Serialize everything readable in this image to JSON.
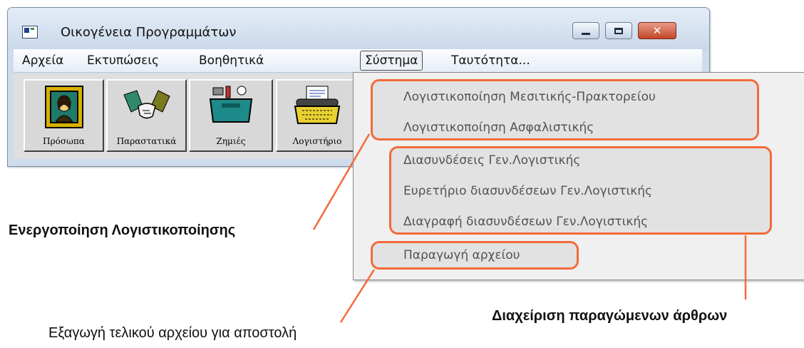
{
  "window": {
    "title": "Οικογένεια Προγραμμάτων"
  },
  "menubar": {
    "items": [
      {
        "label": "Αρχεία"
      },
      {
        "label": "Εκτυπώσεις"
      },
      {
        "label": "Βοηθητικά"
      },
      {
        "label": "Σύστημα"
      },
      {
        "label": "Ταυτότητα..."
      }
    ],
    "active_item": "Σύστημα"
  },
  "toolbar": {
    "buttons": [
      {
        "label": "Πρόσωπα",
        "icon": "portrait-frame-icon"
      },
      {
        "label": "Παραστατικά",
        "icon": "handshake-icon"
      },
      {
        "label": "Ζημιές",
        "icon": "toolbox-icon"
      },
      {
        "label": "Λογιστήριο",
        "icon": "typewriter-icon"
      }
    ]
  },
  "dropdown": {
    "items": [
      {
        "label": "Λογιστικοποίηση  Μεσιτικής-Πρακτορείου"
      },
      {
        "label": "Λογιστικοποίηση  Ασφαλιστικής"
      },
      {
        "label": "Διασυνδέσεις Γεν.Λογιστικής"
      },
      {
        "label": "Ευρετήριο διασυνδέσεων Γεν.Λογιστικής"
      },
      {
        "label": "Διαγραφή διασυνδέσεων Γεν.Λογιστικής"
      },
      {
        "label": "Παραγωγή αρχείου"
      }
    ]
  },
  "annotations": {
    "activation": "Ενεργοποίηση Λογιστικοποίησης",
    "management": "Διαχείριση παραγώμενων άρθρων",
    "export": "Εξαγωγή τελικού αρχείου για αποστολή",
    "highlight_color": "#f46a3a"
  }
}
